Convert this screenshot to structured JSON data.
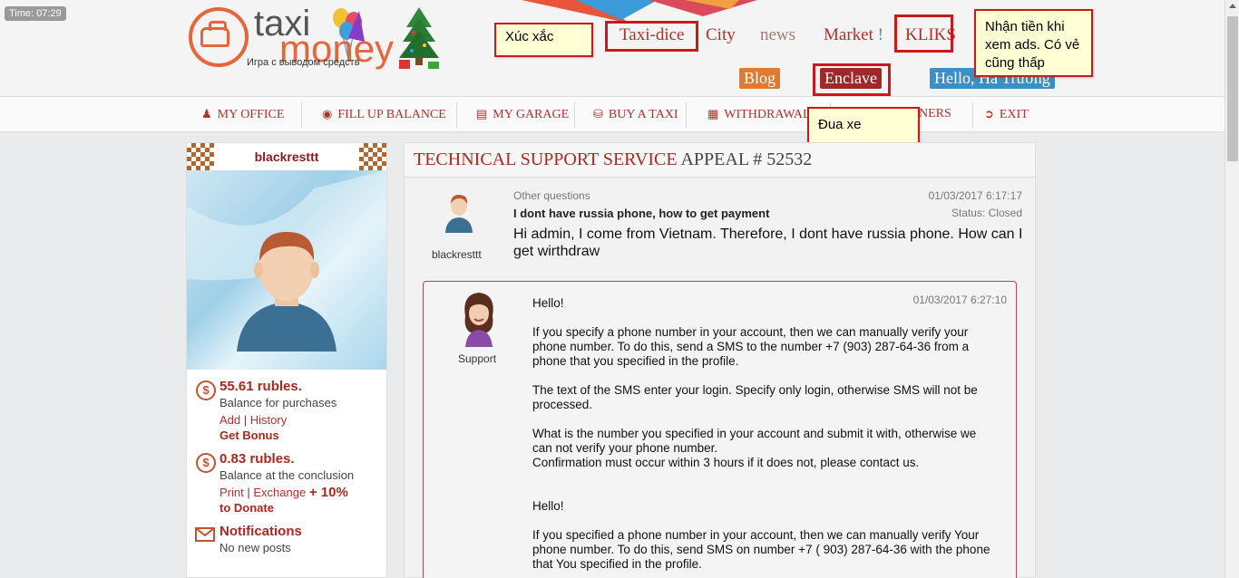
{
  "timer": "Time: 07:29",
  "logo": {
    "line1": "taxi",
    "line2": "money",
    "tagline": "Игра с выводом средств"
  },
  "topnav": [
    {
      "label": "Taxi-dice"
    },
    {
      "label": "City"
    },
    {
      "label": "news"
    },
    {
      "label": "Market"
    },
    {
      "label": "KLIKS"
    }
  ],
  "market_mark": "!",
  "pills": {
    "blog": "Blog",
    "enclave": "Enclave",
    "hello": "Hello, Hà Trường"
  },
  "notes": {
    "dice": "Xúc xắc",
    "ads": "Nhận tiền khi xem ads. Có vẻ cũng thấp",
    "race": "Đua xe"
  },
  "menu": [
    {
      "label": "My office",
      "icon": "person-icon"
    },
    {
      "label": "Fill up balance",
      "icon": "coin-icon"
    },
    {
      "label": "My garage",
      "icon": "card-icon"
    },
    {
      "label": "Buy a taxi",
      "icon": "car-icon"
    },
    {
      "label": "Withdrawals",
      "icon": "ticket-icon"
    },
    {
      "label": "ners",
      "icon": ""
    },
    {
      "label": "Exit",
      "icon": "exit-icon"
    }
  ],
  "sidebar": {
    "username": "blackresttt",
    "purchase_amount": "55.61 rubles.",
    "purchase_label": "Balance for purchases",
    "add": "Add",
    "history": "History",
    "bonus": "Get Bonus",
    "conclusion_amount": "0.83 rubles.",
    "conclusion_label": "Balance at the conclusion",
    "print": "Print",
    "exchange": "Exchange",
    "plus": "+ 10%",
    "donate": "to Donate",
    "notifications": "Notifications",
    "no_posts": "No new posts",
    "sep": "|"
  },
  "ticket": {
    "title_a": "TECHNICAL SUPPORT SERVICE",
    "title_b": "APPEAL # 52532",
    "category": "Other questions",
    "subject": "I dont have russia phone, how to get payment",
    "date": "01/03/2017 6:17:17",
    "status": "Status: Closed",
    "text": "Hi admin, I come from Vietnam. Therefore, I dont have russia phone. How can I get wirthdraw",
    "user": "blackresttt"
  },
  "reply": {
    "user": "Support",
    "date": "01/03/2017 6:27:10",
    "p1": "Hello!",
    "p2": "If you specify a phone number in your account, then we can manually verify your phone number. To do this, send a SMS to the number +7 (903) 287-64-36 from a phone that you specified in the profile.",
    "p3": "The text of the SMS enter your login. Specify only login, otherwise SMS will not be processed.",
    "p4a": "What is the number you specified in your account and submit it with, otherwise we can not verify your phone number.",
    "p4b": "Confirmation must occur within 3 hours if it does not, please contact us.",
    "p5": "Hello!",
    "p6": "If you specified a phone number in your account, then we can manually verify Your phone number. To do this, send SMS on number +7 ( 903) 287-64-36 with the phone that You specified in the profile."
  },
  "colors": {
    "accent": "#b0302a",
    "highlight": "#c81a1a",
    "note_bg": "#fffdd3",
    "blog": "#e07a2e",
    "enclave": "#a02828",
    "hello": "#3b8fc4"
  }
}
